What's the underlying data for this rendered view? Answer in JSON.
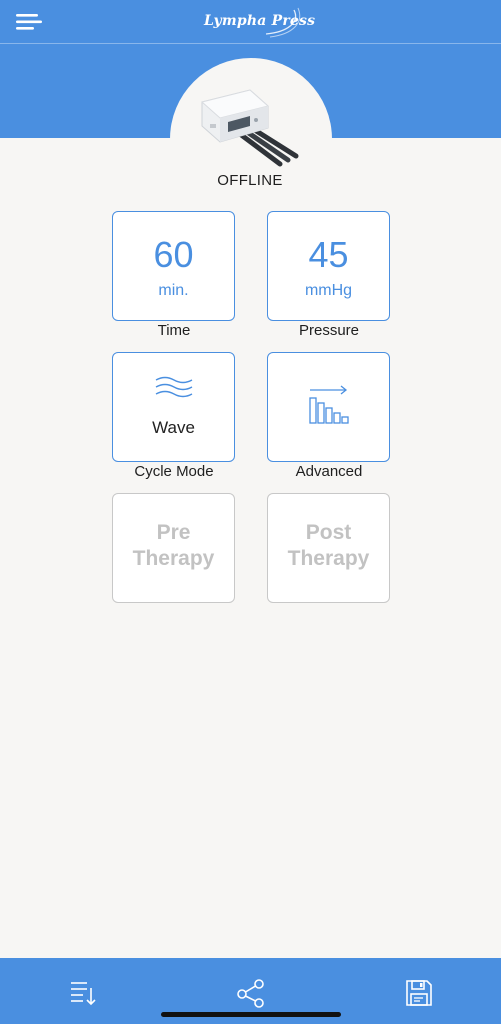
{
  "header": {
    "brand": "Lympha Press",
    "menu_icon": "menu-icon"
  },
  "device": {
    "status": "OFFLINE",
    "image_icon": "pump-device-image"
  },
  "tiles": {
    "time": {
      "value": "60",
      "unit": "min.",
      "label": "Time"
    },
    "pressure": {
      "value": "45",
      "unit": "mmHg",
      "label": "Pressure"
    },
    "cycle_mode": {
      "value": "Wave",
      "label": "Cycle Mode",
      "icon": "wave-icon"
    },
    "advanced": {
      "label": "Advanced",
      "icon": "bar-chart-arrow-icon"
    },
    "pre_therapy": {
      "line1": "Pre",
      "line2": "Therapy"
    },
    "post_therapy": {
      "line1": "Post",
      "line2": "Therapy"
    }
  },
  "footer": {
    "icons": [
      "list-sort-icon",
      "share-icon",
      "save-icon"
    ]
  },
  "colors": {
    "primary": "#4a8fe0",
    "background": "#f7f6f4",
    "disabled": "#c2c2c2"
  }
}
